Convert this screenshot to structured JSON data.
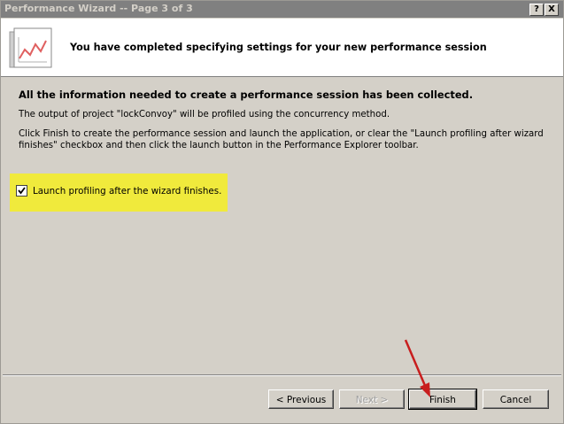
{
  "window": {
    "title": "Performance Wizard -- Page 3 of 3"
  },
  "titlebar_buttons": {
    "help": "?",
    "close": "X"
  },
  "header": {
    "text": "You have completed specifying settings for your new performance session",
    "icon": "chart-document-icon"
  },
  "body": {
    "heading": "All the information needed to create a performance session has been collected.",
    "output_line": "The output of project  \"lockConvoy\" will be profiled using the concurrency method.",
    "instruction_line1": "Click Finish to create the performance session and launch the application, or clear the \"Launch profiling after wizard",
    "instruction_line2": "finishes\" checkbox and then click the launch button in the Performance Explorer toolbar."
  },
  "checkbox": {
    "label": "Launch profiling after the wizard finishes.",
    "checked": true,
    "highlight_color": "#f0ea3c"
  },
  "buttons": {
    "previous": "< Previous",
    "next": "Next >",
    "finish": "Finish",
    "cancel": "Cancel"
  },
  "annotation": {
    "arrow_color": "#c81e1e"
  }
}
